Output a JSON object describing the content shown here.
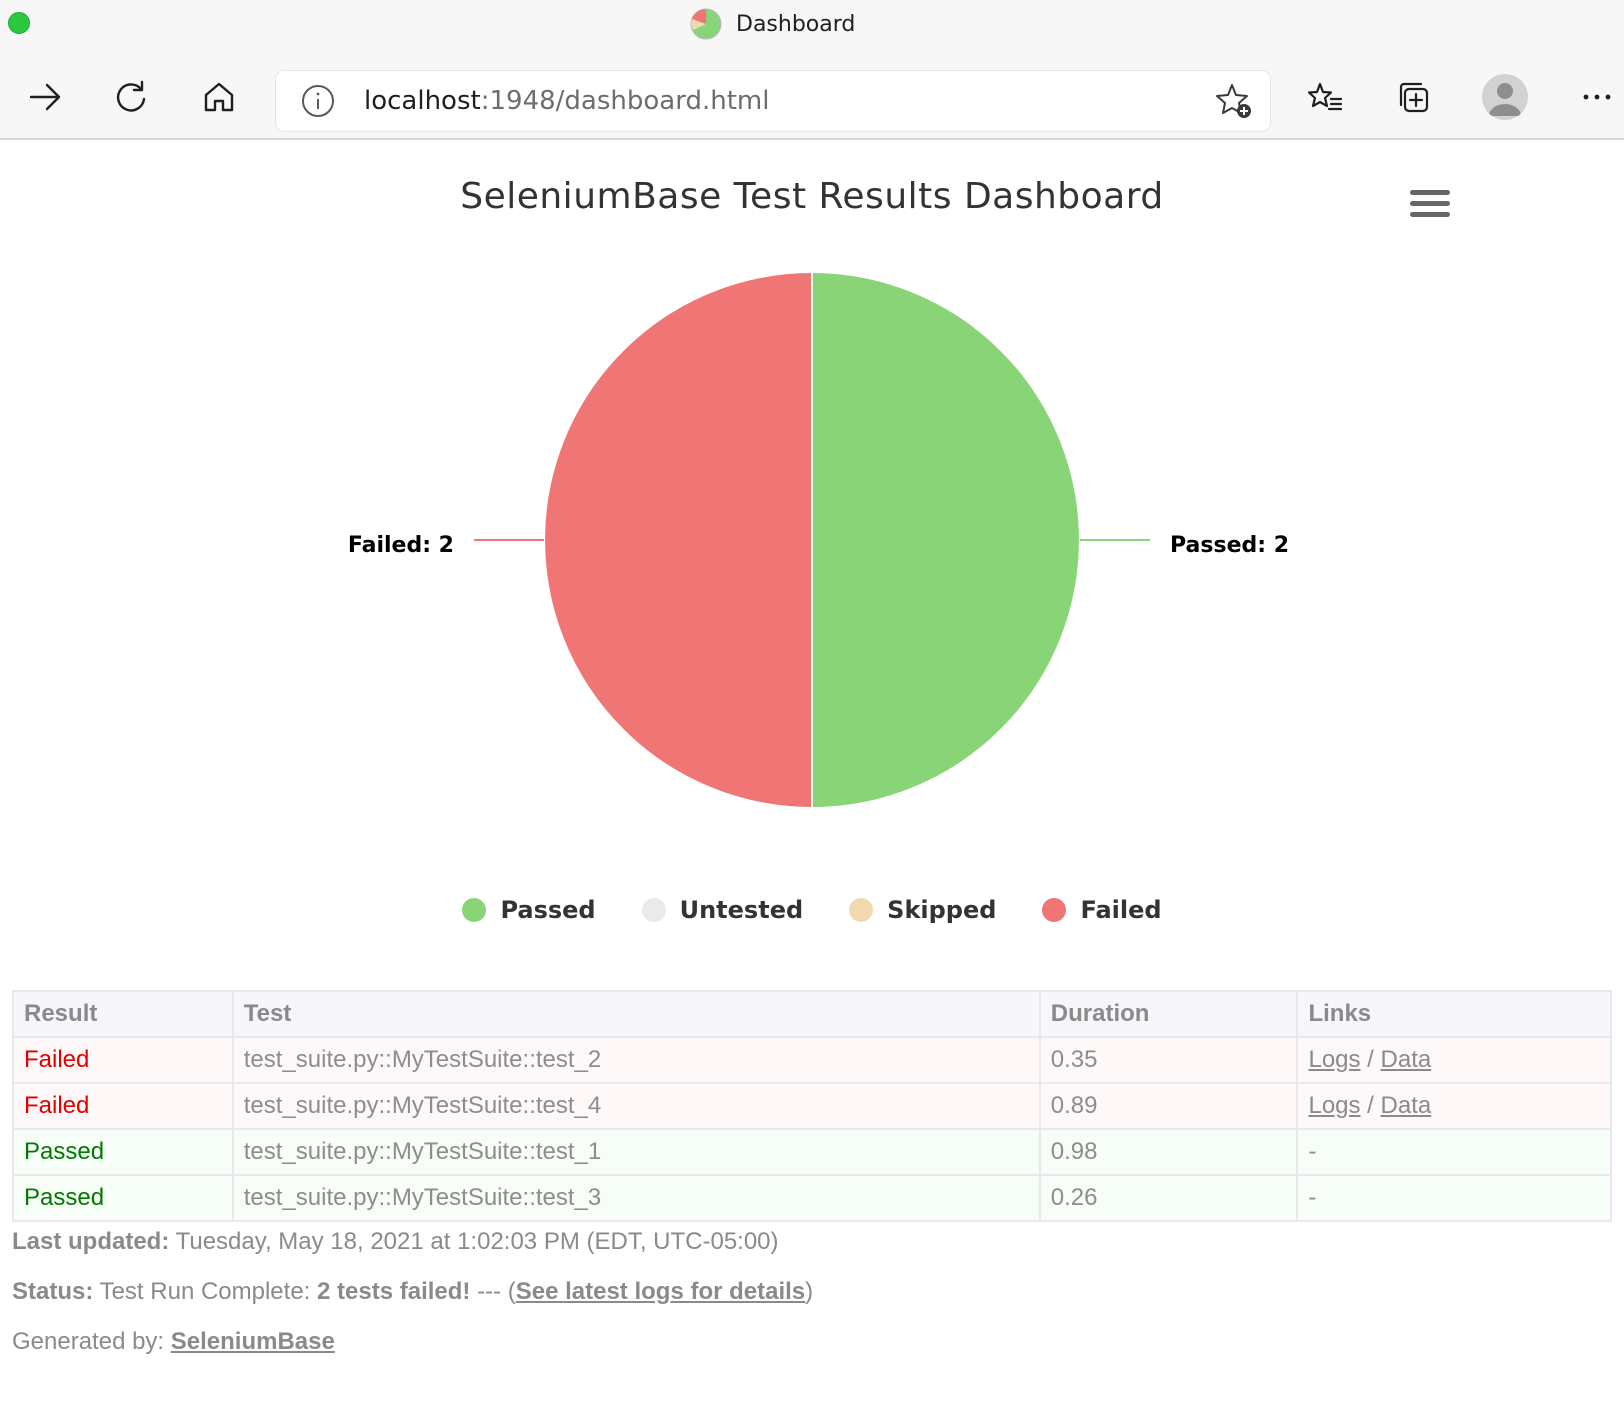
{
  "window": {
    "tab_title": "Dashboard"
  },
  "toolbar": {
    "url_host": "localhost",
    "url_path": ":1948/dashboard.html"
  },
  "page": {
    "title": "SeleniumBase Test Results Dashboard"
  },
  "colors": {
    "passed": "#88d476",
    "untested": "#eaeaea",
    "skipped": "#f2d9b0",
    "failed": "#f07676"
  },
  "chart_data": {
    "type": "pie",
    "title": "SeleniumBase Test Results Dashboard",
    "slices": [
      {
        "name": "Passed",
        "value": 2,
        "label": "Passed: 2",
        "color": "#88d476"
      },
      {
        "name": "Untested",
        "value": 0,
        "color": "#eaeaea"
      },
      {
        "name": "Skipped",
        "value": 0,
        "color": "#f2d9b0"
      },
      {
        "name": "Failed",
        "value": 2,
        "label": "Failed: 2",
        "color": "#f07676"
      }
    ],
    "legend_position": "bottom"
  },
  "table": {
    "headers": [
      "Result",
      "Test",
      "Duration",
      "Links"
    ],
    "rows": [
      {
        "result": "Failed",
        "test": "test_suite.py::MyTestSuite::test_2",
        "duration": "0.35",
        "logs": "Logs",
        "sep": " / ",
        "data": "Data"
      },
      {
        "result": "Failed",
        "test": "test_suite.py::MyTestSuite::test_4",
        "duration": "0.89",
        "logs": "Logs",
        "sep": " / ",
        "data": "Data"
      },
      {
        "result": "Passed",
        "test": "test_suite.py::MyTestSuite::test_1",
        "duration": "0.98",
        "dash": "-"
      },
      {
        "result": "Passed",
        "test": "test_suite.py::MyTestSuite::test_3",
        "duration": "0.26",
        "dash": "-"
      }
    ]
  },
  "footer": {
    "updated_label": "Last updated:",
    "updated_value": " Tuesday, May 18, 2021 at 1:02:03 PM (EDT, UTC-05:00)",
    "status_label": "Status:",
    "status_text": " Test Run Complete: ",
    "status_bold": "2 tests failed!",
    "status_mid": " --- (",
    "status_link": "See latest logs for details",
    "status_end": ")",
    "generated_label": "Generated by: ",
    "generated_link": "SeleniumBase"
  }
}
